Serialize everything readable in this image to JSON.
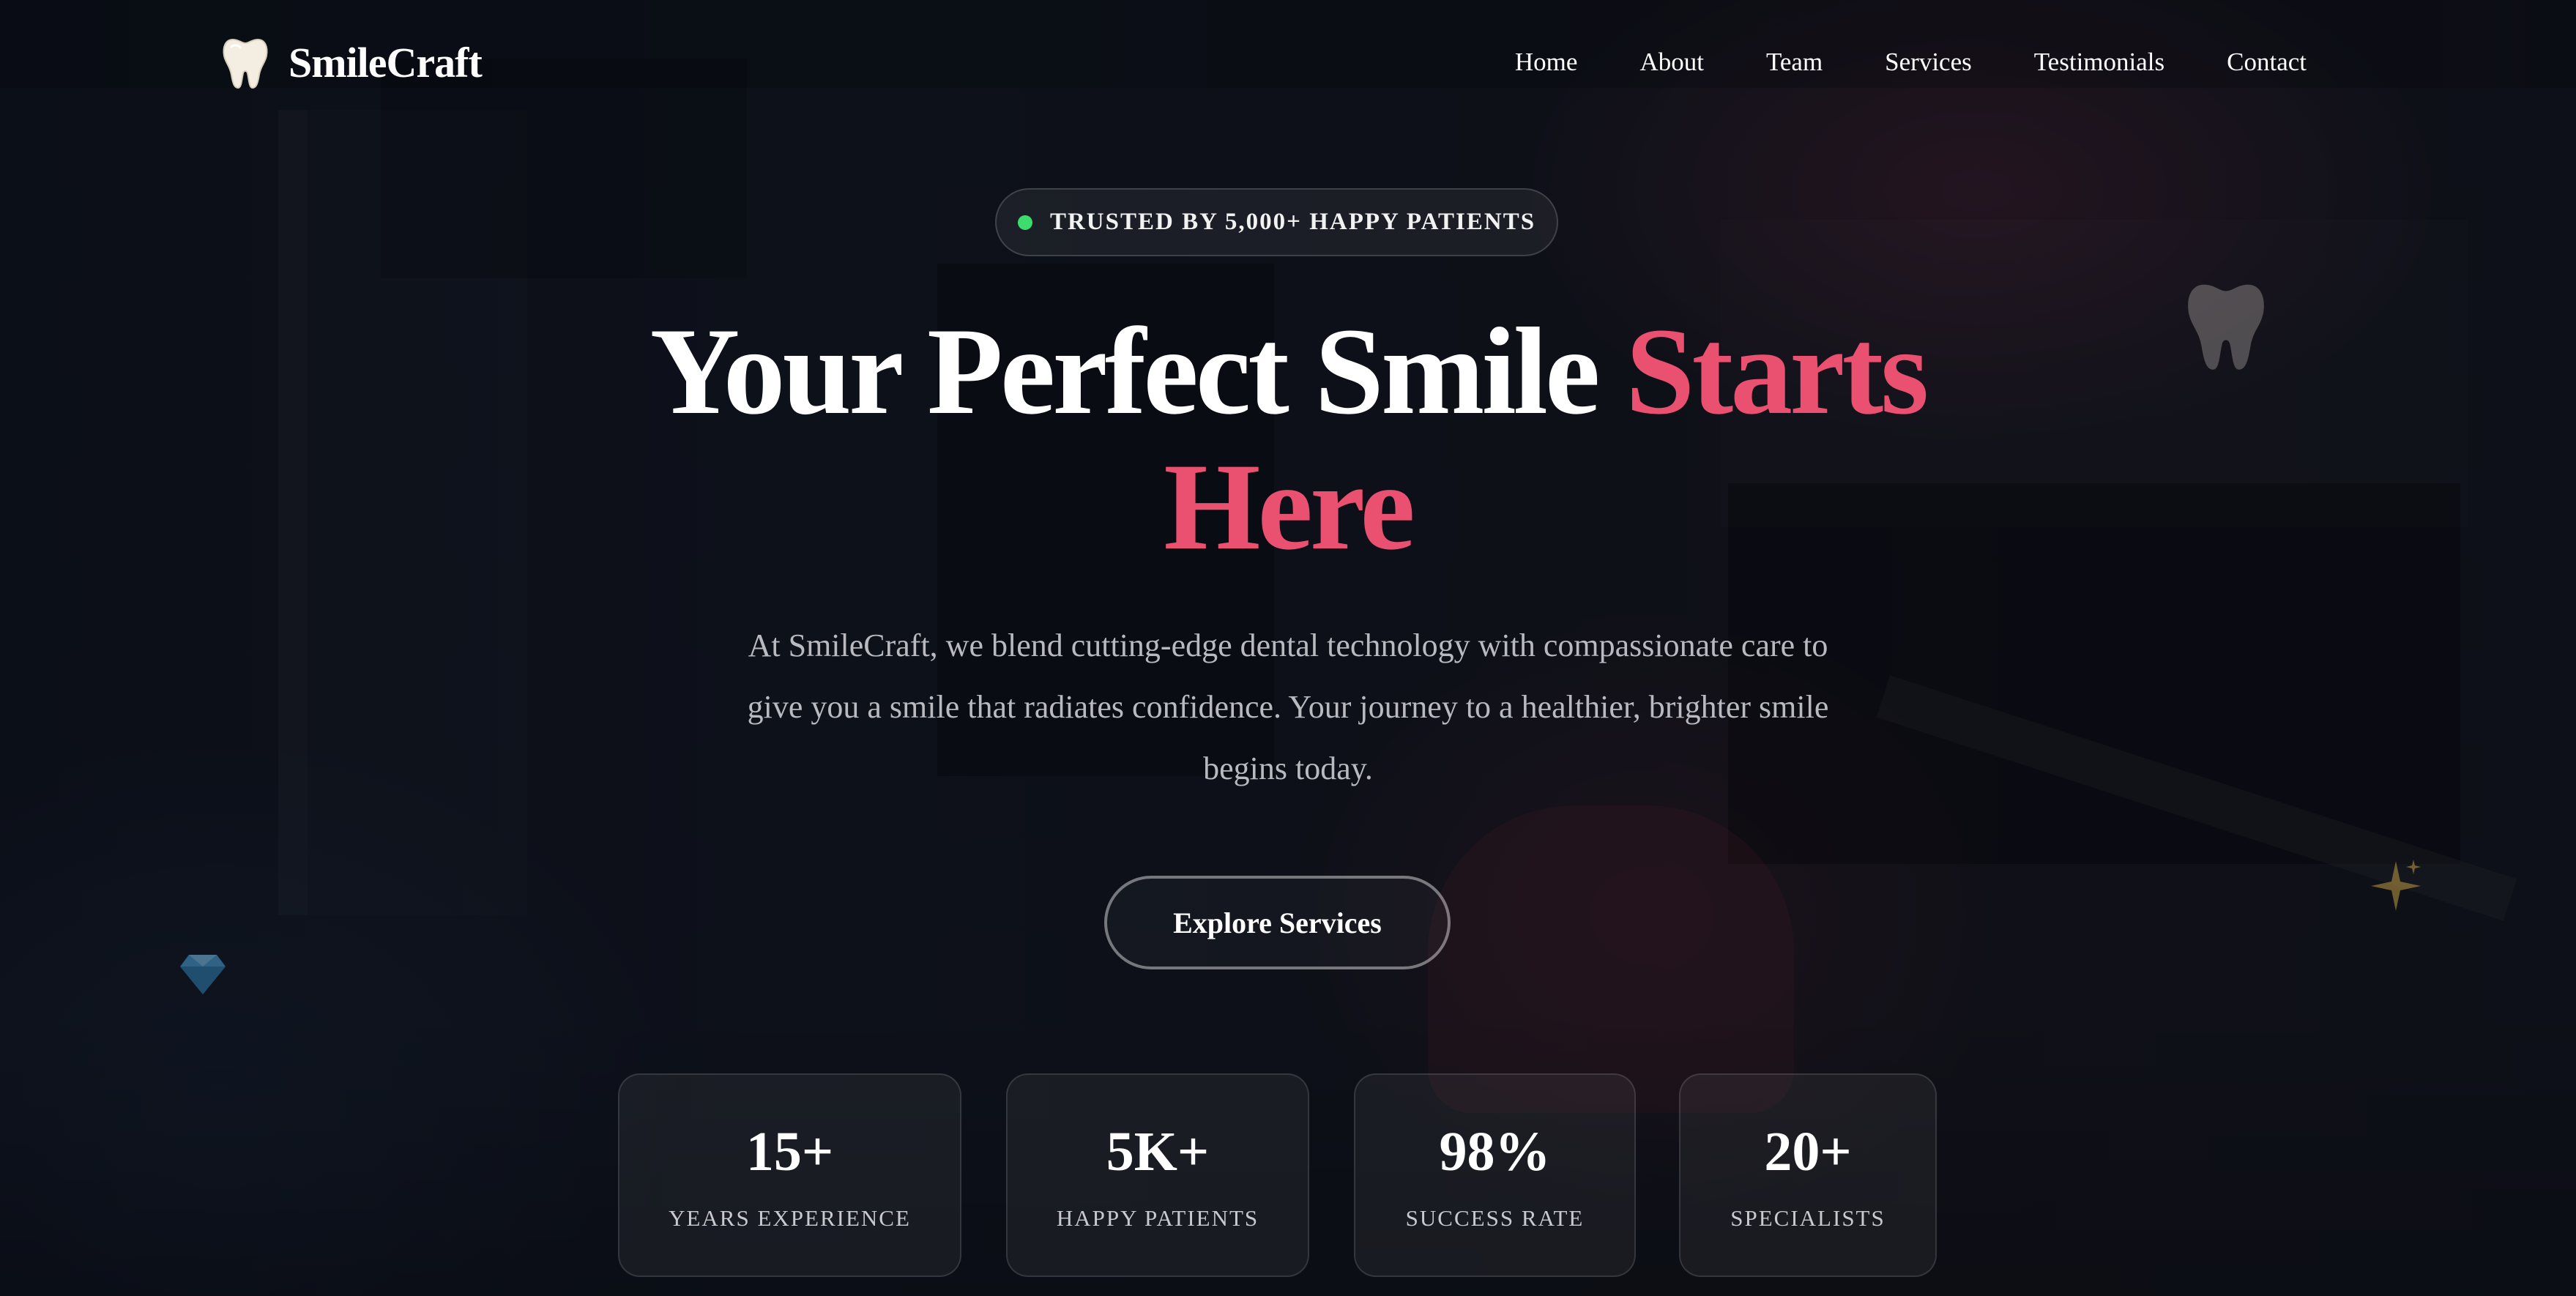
{
  "brand": {
    "name": "SmileCraft",
    "icon": "tooth-icon"
  },
  "nav": {
    "items": [
      {
        "label": "Home"
      },
      {
        "label": "About"
      },
      {
        "label": "Team"
      },
      {
        "label": "Services"
      },
      {
        "label": "Testimonials"
      },
      {
        "label": "Contact"
      }
    ]
  },
  "badge": {
    "text": "TRUSTED BY 5,000+ HAPPY PATIENTS",
    "dot_color": "#3ddc6e"
  },
  "hero": {
    "title_main": "Your Perfect Smile",
    "title_accent_1": "Starts",
    "title_accent_2": "Here",
    "accent_color": "#ea5070",
    "subtitle": "At SmileCraft, we blend cutting-edge dental technology with compassionate care to give you a smile that radiates confidence. Your journey to a healthier, brighter smile begins today.",
    "cta_label": "Explore Services"
  },
  "stats": [
    {
      "value": "15+",
      "label": "YEARS EXPERIENCE"
    },
    {
      "value": "5K+",
      "label": "HAPPY PATIENTS"
    },
    {
      "value": "98%",
      "label": "SUCCESS RATE"
    },
    {
      "value": "20+",
      "label": "SPECIALISTS"
    }
  ],
  "decorations": [
    "tooth-icon",
    "gem-icon",
    "sparkle-icon"
  ]
}
